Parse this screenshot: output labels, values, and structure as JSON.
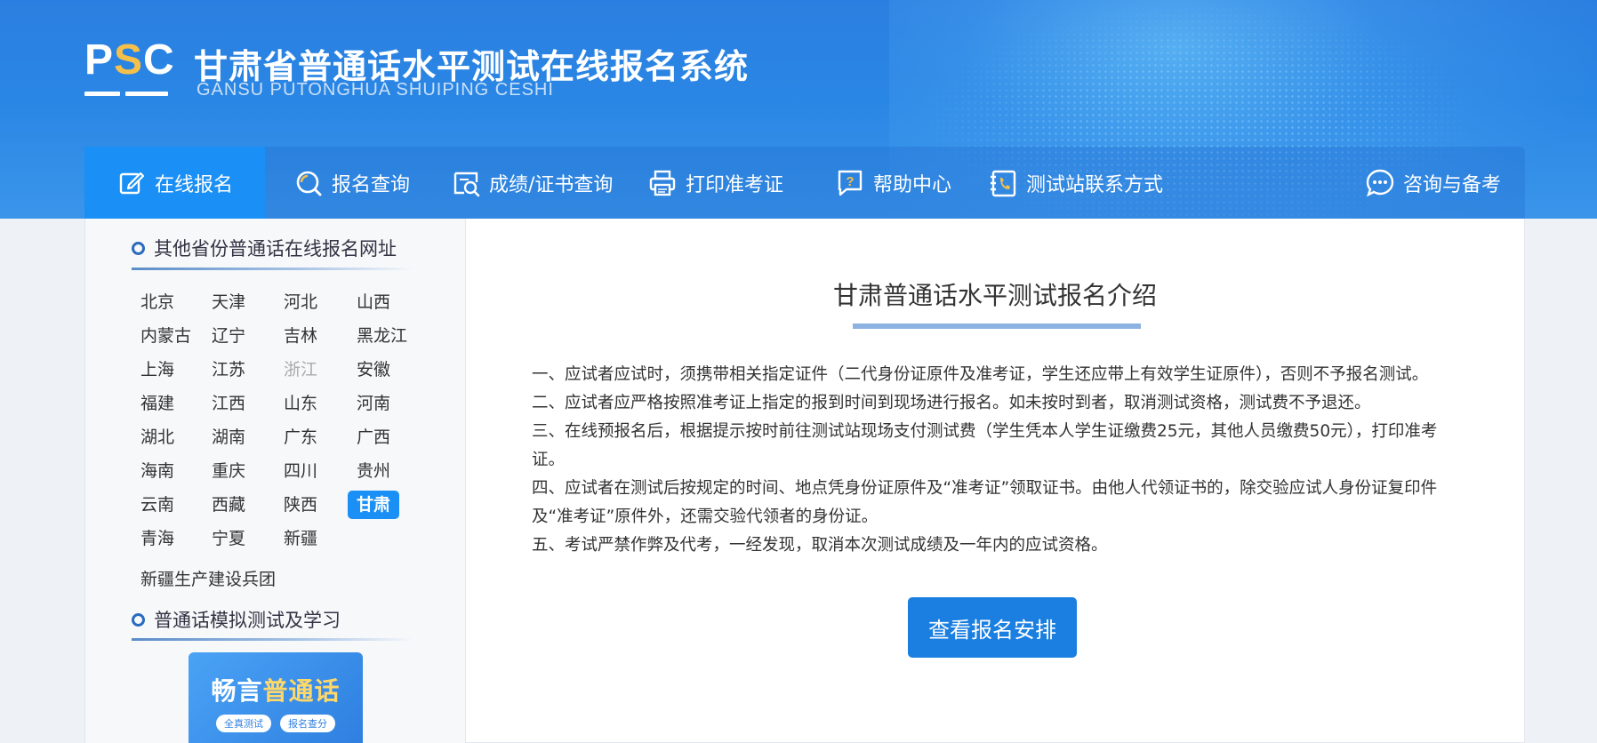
{
  "header": {
    "logo_text_p": "P",
    "logo_text_s": "S",
    "logo_text_c": "C",
    "title": "甘肃省普通话水平测试在线报名系统",
    "subtitle": "GANSU PUTONGHUA SHUIPING CESHI"
  },
  "nav": {
    "items": [
      {
        "label": "在线报名",
        "icon": "edit-icon",
        "active": true
      },
      {
        "label": "报名查询",
        "icon": "search-icon"
      },
      {
        "label": "成绩/证书查询",
        "icon": "certificate-search-icon"
      },
      {
        "label": "打印准考证",
        "icon": "printer-icon"
      },
      {
        "label": "帮助中心",
        "icon": "help-icon"
      },
      {
        "label": "测试站联系方式",
        "icon": "phone-book-icon"
      },
      {
        "label": "咨询与备考",
        "icon": "chat-icon"
      }
    ]
  },
  "sidebar": {
    "provinces_heading": "其他省份普通话在线报名网址",
    "provinces": [
      "北京",
      "天津",
      "河北",
      "山西",
      "内蒙古",
      "辽宁",
      "吉林",
      "黑龙江",
      "上海",
      "江苏",
      "浙江",
      "安徽",
      "福建",
      "江西",
      "山东",
      "河南",
      "湖北",
      "湖南",
      "广东",
      "广西",
      "海南",
      "重庆",
      "四川",
      "贵州",
      "云南",
      "西藏",
      "陕西",
      "甘肃",
      "青海",
      "宁夏",
      "新疆"
    ],
    "active_province": "甘肃",
    "dimmed_province": "浙江",
    "extra_link": "新疆生产建设兵团",
    "practice_heading": "普通话模拟测试及学习",
    "promo": {
      "title_a": "畅言",
      "title_b": "普通话",
      "tag1": "全真测试",
      "tag2": "报名查分"
    }
  },
  "article": {
    "title": "甘肃普通话水平测试报名介绍",
    "paragraphs": [
      "一、应试者应试时，须携带相关指定证件（二代身份证原件及准考证，学生还应带上有效学生证原件），否则不予报名测试。",
      "二、应试者应严格按照准考证上指定的报到时间到现场进行报名。如未按时到者，取消测试资格，测试费不予退还。",
      "三、在线预报名后，根据提示按时前往测试站现场支付测试费（学生凭本人学生证缴费25元，其他人员缴费50元），打印准考证。",
      "四、应试者在测试后按规定的时间、地点凭身份证原件及“准考证”领取证书。由他人代领证书的，除交验应试人身份证复印件及“准考证”原件外，还需交验代领者的身份证。",
      "五、考试严禁作弊及代考，一经发现，取消本次测试成绩及一年内的应试资格。"
    ],
    "cta_label": "查看报名安排"
  },
  "colors": {
    "primary": "#1a8ff5",
    "header_blue": "#2b7fe0",
    "cta": "#1a7fe0",
    "logo_accent": "#f5c04a"
  }
}
